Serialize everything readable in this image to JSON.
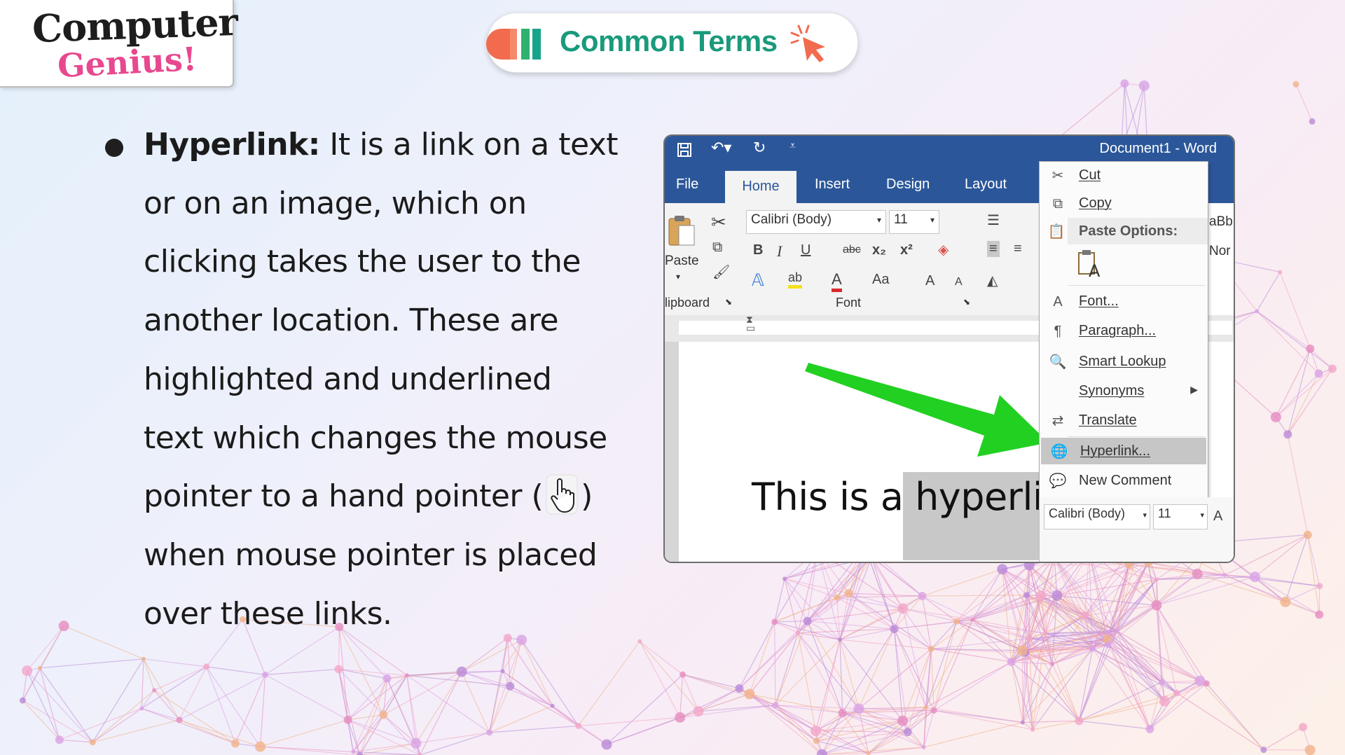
{
  "logo": {
    "line1": "Computer",
    "line2": "Genius!"
  },
  "header": {
    "title": "Common Terms",
    "cursor_icon": "cursor-click-icon"
  },
  "content": {
    "term": "Hyperlink:",
    "text_a": " It is a link on a text or on an image, which on clicking takes the user to the another location. These are highlighted and underlined text which changes the mouse pointer to a hand pointer (",
    "text_b": ") when mouse pointer is placed over these links."
  },
  "word": {
    "title": "Document1  -  Word",
    "tabs": {
      "file": "File",
      "home": "Home",
      "insert": "Insert",
      "design": "Design",
      "layout": "Layout"
    },
    "ribbon": {
      "paste": "Paste",
      "clipboard": "lipboard",
      "font_name": "Calibri (Body)",
      "font_size": "11",
      "bold": "B",
      "italic": "I",
      "underline": "U",
      "strike": "abc",
      "sub": "x₂",
      "sup": "x²",
      "font_color": "A",
      "case": "Aa",
      "grow": "A",
      "shrink": "A",
      "font_group": "Font",
      "style1": "aBb(",
      "style2": "Nor"
    },
    "doc_text": "This is a hyperlink.",
    "context_menu": {
      "cut": "Cut",
      "copy": "Copy",
      "paste_options": "Paste Options:",
      "font_letter": "A",
      "font": "Font...",
      "paragraph": "Paragraph...",
      "smart_lookup": "Smart Lookup",
      "synonyms": "Synonyms",
      "translate": "Translate",
      "hyperlink": "Hyperlink...",
      "new_comment": "New Comment"
    },
    "minibar": {
      "font_name": "Calibri (Body)",
      "font_size": "11",
      "grow": "A"
    }
  },
  "colors": {
    "title_green": "#1a9a7c",
    "word_blue": "#2b579a",
    "arrow_green": "#22d022",
    "logo_pink": "#e8488f"
  }
}
